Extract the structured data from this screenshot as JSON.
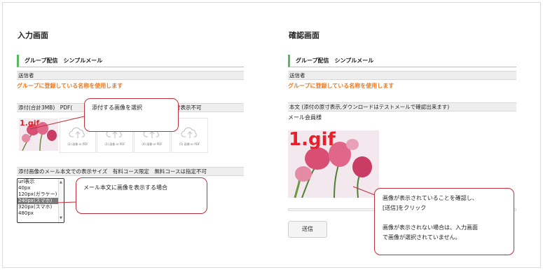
{
  "input_screen": {
    "heading": "入力画面",
    "group_title": "グループ配信　シンプルメール",
    "sender_label": "送信者",
    "sender_note": "グループに登録している名称を使用します",
    "attachment_label": "添付(合計3MB)　PDF(",
    "attachment_label_tail": "付表示不可",
    "overlay_filename": "1.gif",
    "upload_tiles": [
      "(2) 画像 or PDF",
      "(3) 画像 or PDF",
      "(4) 画像 or PDF",
      "(5) 画像 or PDF"
    ],
    "display_size_label": "添付画像のメール本文での表示サイズ　有料コース限定　無料コースは指定不可",
    "display_size_options": [
      "url表示",
      "40px",
      "120px(ガラケー)",
      "240px(スマホ)",
      "320px(スマホ)",
      "480px"
    ],
    "selected_option": "240px(スマホ)"
  },
  "confirm_screen": {
    "heading": "確認画面",
    "group_title": "グループ配信　シンプルメール",
    "sender_label": "送信者",
    "sender_note": "グループに登録している名称を使用します",
    "body_label": "本文 (添付の原寸表示,ダウンロードはテストメールで確認出来ます)",
    "body_text": "メール会員様",
    "overlay_filename": "1.gif",
    "send_button": "送信"
  },
  "callouts": {
    "select_image": "添付する画像を選択",
    "display_in_body": "メール本文に画像を表示する場合",
    "confirm_lines": [
      "画像が表示されていることを確認し、",
      "[送信]をクリック",
      "",
      "画像が表示されない場合は、入力画面",
      "で画像が選択されていません。"
    ]
  },
  "colors": {
    "accent_green": "#5cb85c",
    "notice_orange": "#f0781e",
    "callout_border": "#c0303a",
    "overlay_red": "#e8202a"
  },
  "icons": {
    "upload": "cloud-upload-icon"
  }
}
